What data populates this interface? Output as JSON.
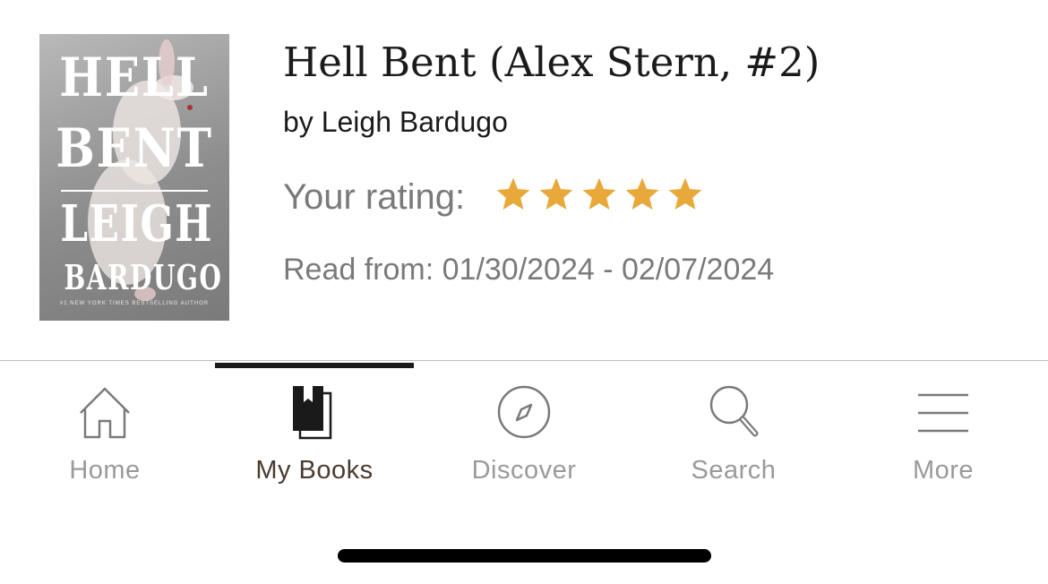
{
  "book": {
    "title": "Hell Bent (Alex Stern, #2)",
    "author": "by Leigh Bardugo",
    "rating_label": "Your rating:",
    "rating_value": 5,
    "rating_max": 5,
    "dates": "Read from: 01/30/2024 - 02/07/2024",
    "cover": {
      "title_line1": "HELL",
      "title_line2": "BENT",
      "author_line1": "LEIGH",
      "author_line2": "BARDUGO",
      "tagline": "#1 NEW YORK TIMES BESTSELLING AUTHOR"
    }
  },
  "colors": {
    "star": "#E8A93A",
    "active_tab": "#4B3B30",
    "inactive_tab": "#9A9A9A"
  },
  "tabs": [
    {
      "label": "Home",
      "icon": "home-icon",
      "active": false
    },
    {
      "label": "My Books",
      "icon": "my-books-icon",
      "active": true
    },
    {
      "label": "Discover",
      "icon": "compass-icon",
      "active": false
    },
    {
      "label": "Search",
      "icon": "search-icon",
      "active": false
    },
    {
      "label": "More",
      "icon": "menu-icon",
      "active": false
    }
  ]
}
